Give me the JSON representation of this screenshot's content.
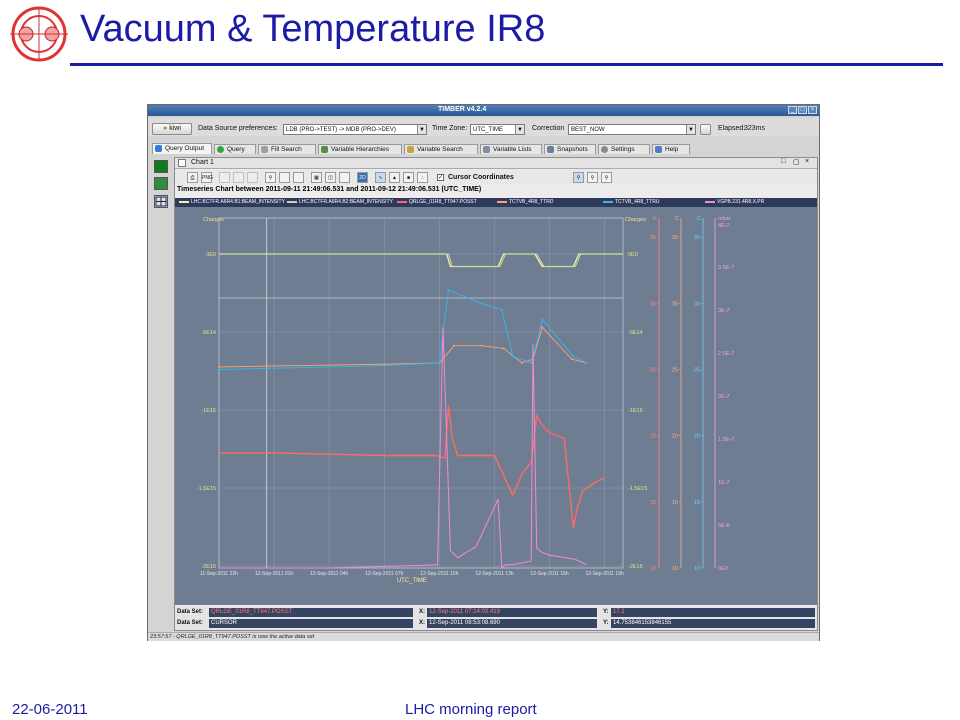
{
  "slide": {
    "title": "Vacuum & Temperature IR8",
    "footer_date": "22-06-2011",
    "footer_center": "LHC morning report"
  },
  "app": {
    "window_title": "TIMBER v4.2.4",
    "kiwi_label": "kiwi",
    "data_source_label": "Data Source preferences:",
    "data_source_value": "LDB (PRO->TEST) -> MDB (PRO->DEV)",
    "time_zone_label": "Time Zone:",
    "time_zone_value": "UTC_TIME",
    "correction_label": "Correction",
    "correction_value": "BEST_NOW",
    "elapsed_label": "Elapsed:",
    "elapsed_value": "323ms",
    "tabs": [
      {
        "label": "Query Output",
        "active": true
      },
      {
        "label": "Query",
        "active": false
      },
      {
        "label": "Fill Search",
        "active": false
      },
      {
        "label": "Variable Hierarchies",
        "active": false
      },
      {
        "label": "Variable Search",
        "active": false
      },
      {
        "label": "Variable Lists",
        "active": false
      },
      {
        "label": "Snapshots",
        "active": false
      },
      {
        "label": "Settings",
        "active": false
      },
      {
        "label": "Help",
        "active": false
      }
    ],
    "chart_window_title": "Chart 1",
    "tool_labels": {
      "png": "PNG",
      "mode_2d": "2D"
    },
    "cursor_coordinates_label": "Cursor Coordinates",
    "chart_caption": "Timeseries Chart between 2011-09-11 21:49:06.531 and 2011-09-12 21:49:06.531 (UTC_TIME)",
    "dataset_label": "Data Set:",
    "x_label": "X:",
    "y_label": "Y:",
    "datasets": [
      {
        "name": "QRLGE_01R8_TT947.POSST",
        "x": "12-Sep-2011 07:14:03.419",
        "y": "17.1"
      },
      {
        "name": "CURSOR",
        "x": "12-Sep-2011 08:53:08.690",
        "y": "14.753846153846155"
      }
    ],
    "status_text": "23:57:57 - QRLGE_01R8_TT947.POSST is now the active data set",
    "colors": {
      "plot_bg": "#6f7d93",
      "beam1": "#f6f2a0",
      "beam2": "#c9d9a4",
      "posst": "#ff6a64",
      "ttrd": "#ffa06e",
      "ttru": "#35b8e8",
      "pressure": "#f08ad8",
      "title_blue": "#1b1ba6"
    }
  },
  "chart_data": {
    "type": "line",
    "title": "Timeseries Chart between 2011-09-11 21:49:06.531 and 2011-09-12 21:49:06.531 (UTC_TIME)",
    "xlabel": "UTC_TIME",
    "x_ticks": [
      "11-Sep-2011 22h",
      "12-Sep-2011 01h",
      "12-Sep-2011 04h",
      "12-Sep-2011 07h",
      "12-Sep-2011 10h",
      "12-Sep-2011 13h",
      "12-Sep-2011 16h",
      "12-Sep-2011 19h"
    ],
    "x_hours": [
      0,
      3,
      6,
      9,
      12,
      15,
      18,
      21
    ],
    "left_axis": {
      "label": "Charges",
      "ticks": [
        "0E0",
        "-5E14",
        "-1E15",
        "-1.5E15",
        "-2E15"
      ],
      "values": [
        0,
        -500000000000000.0,
        -1000000000000000.0,
        -1500000000000000.0,
        -2000000000000000.0
      ]
    },
    "right_axis_charges": {
      "label": "Charges",
      "ticks": [
        "0E0",
        "-5E14",
        "-1E15",
        "-1.5E15",
        "-2E15"
      ]
    },
    "axis_k": {
      "label": "K",
      "ticks": [
        "35",
        "30",
        "25",
        "20",
        "15",
        "10"
      ]
    },
    "axis_c1": {
      "label": "C",
      "ticks": [
        "35",
        "30",
        "25",
        "20",
        "15",
        "10"
      ]
    },
    "axis_c2": {
      "label": "C",
      "ticks": [
        "35",
        "30",
        "25",
        "20",
        "15",
        "10"
      ]
    },
    "axis_mbar": {
      "label": "mbar",
      "ticks": [
        "3.5E-7",
        "3E-7",
        "2.5E-7",
        "2E-7",
        "1.5E-7",
        "1E-7",
        "5E-8",
        "0E0"
      ],
      "max_label": "4E-7"
    },
    "series": [
      {
        "name": "LHC.BCTFR.A6R4.B1:BEAM_INTENSITY",
        "axis": "charges",
        "x": [
          0,
          12.4,
          12.6,
          13.2,
          15.2,
          15.5,
          17.2,
          17.6,
          18.3,
          18.7,
          19.3,
          19.6,
          22
        ],
        "y": [
          0,
          0,
          -80000000000000.0,
          -80000000000000.0,
          -80000000000000.0,
          0,
          0,
          -80000000000000.0,
          -80000000000000.0,
          -80000000000000.0,
          -80000000000000.0,
          0,
          0
        ]
      },
      {
        "name": "LHC.BCTFR.A6R4.B2:BEAM_INTENSITY",
        "axis": "charges",
        "x": [
          0,
          12.5,
          12.7,
          15.3,
          15.6,
          17.3,
          17.7,
          19.4,
          19.7,
          22
        ],
        "y": [
          0,
          0,
          -80000000000000.0,
          -80000000000000.0,
          0,
          0,
          -80000000000000.0,
          -80000000000000.0,
          0,
          0
        ]
      },
      {
        "name": "QRLGE_01R8_TT947.POSST",
        "axis": "k",
        "x": [
          0,
          3,
          6,
          9,
          11.8,
          12.3,
          12.5,
          12.7,
          13,
          15,
          16,
          16.5,
          17,
          17.1,
          17.3,
          17.6,
          18,
          18.8,
          19.3,
          19.5,
          19.8,
          20.5,
          21
        ],
        "y": [
          18.7,
          18.7,
          18.6,
          18.5,
          18.5,
          18.3,
          22.3,
          19.8,
          18.5,
          18.5,
          15.5,
          17.1,
          18,
          19,
          21.5,
          20.8,
          20.2,
          19.8,
          13,
          14.5,
          15.8,
          16.5,
          16.8
        ]
      },
      {
        "name": "TCTVB_4R8_TTRD",
        "axis": "c1",
        "x": [
          0,
          9,
          12,
          12.8,
          14.3,
          15.5,
          16.5,
          17.1,
          17.6,
          19.2,
          20
        ],
        "y": [
          25.2,
          25.4,
          25.5,
          26.8,
          26.8,
          26.6,
          25.5,
          25.8,
          28.2,
          25.8,
          25.5
        ]
      },
      {
        "name": "TCTVB_4R8_TTRU",
        "axis": "c1",
        "x": [
          0,
          9,
          12,
          12.5,
          14.3,
          15.4,
          16,
          17,
          17.2,
          17.6,
          19.3,
          20
        ],
        "y": [
          25,
          25.3,
          25.5,
          31,
          30,
          29.5,
          26,
          25.5,
          26.5,
          28.8,
          26,
          25.5
        ]
      },
      {
        "name": "VGPB.231.4R8.X.PR",
        "axis": "mbar",
        "x": [
          0,
          6,
          11,
          11.9,
          12.2,
          12.6,
          13,
          14,
          15.2,
          15.4,
          15.6,
          16,
          17,
          17.1,
          17.3,
          17.6,
          18,
          19.4,
          20
        ],
        "y": [
          0,
          0,
          3e-09,
          4e-09,
          2.8e-07,
          2e-08,
          1.2e-08,
          2.5e-08,
          8e-08,
          0,
          4e-09,
          4e-09,
          8e-09,
          2.6e-07,
          2.3e-08,
          1.8e-08,
          1.5e-08,
          1e-08,
          4e-09
        ]
      }
    ],
    "grid": true,
    "legend": "top"
  }
}
